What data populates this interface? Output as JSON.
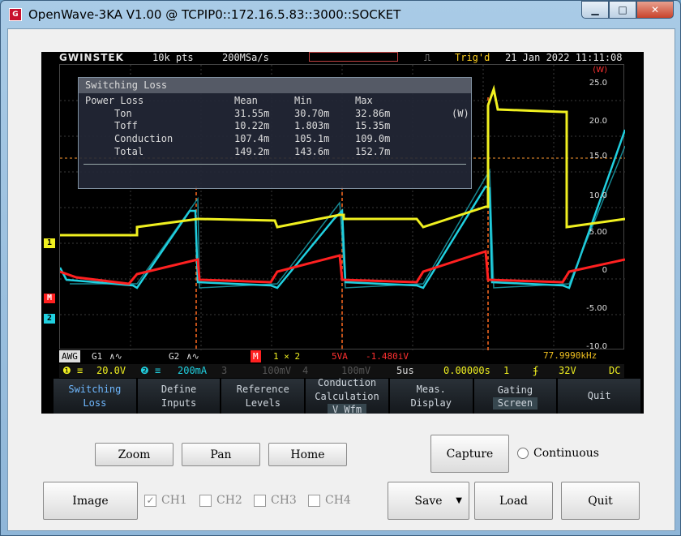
{
  "window": {
    "title": "OpenWave-3KA V1.00 @ TCPIP0::172.16.5.83::3000::SOCKET",
    "icon_text": "G",
    "minimize": "▁",
    "maximize": "□",
    "close": "✕"
  },
  "scope": {
    "brand": "GWINSTEK",
    "points": "10k pts",
    "sample_rate": "200MSa/s",
    "trig_state": "Trig'd",
    "datetime": "21 Jan 2022 11:11:08",
    "freq": "77.9990kHz",
    "right_axis_unit": "(W)",
    "right_axis": [
      "25.0",
      "20.0",
      "15.0",
      "10.0",
      "5.00",
      "0",
      "-5.00",
      "-10.0"
    ],
    "markers": {
      "ch1": "1",
      "math": "M",
      "ch2": "2"
    },
    "panel": {
      "title": "Switching Loss",
      "headers": [
        "Power Loss",
        "Mean",
        "Min",
        "Max"
      ],
      "rows": [
        {
          "name": "Ton",
          "mean": "31.55m",
          "min": "30.70m",
          "max": "32.86m",
          "unit": "(W)"
        },
        {
          "name": "Toff",
          "mean": "10.22m",
          "min": "1.803m",
          "max": "15.35m",
          "unit": ""
        },
        {
          "name": "Conduction",
          "mean": "107.4m",
          "min": "105.1m",
          "max": "109.0m",
          "unit": ""
        },
        {
          "name": "Total",
          "mean": "149.2m",
          "min": "143.6m",
          "max": "152.7m",
          "unit": ""
        }
      ]
    },
    "status1": {
      "awg": "AWG",
      "g1": "G1",
      "g2": "G2",
      "math": "M",
      "math_src": "1 × 2",
      "math_scale": "5VA",
      "math_offset": "-1.480iV"
    },
    "status2": {
      "ch1": "20.0V",
      "ch2": "200mA",
      "ch3": "100mV",
      "ch4": "100mV",
      "timebase": "5us",
      "hpos": "0.00000s",
      "trig_ch": "1",
      "trig_level": "32V",
      "coupling": "DC"
    },
    "softkeys": [
      {
        "line1": "Switching",
        "line2": "Loss",
        "active": true
      },
      {
        "line1": "Define",
        "line2": "Inputs"
      },
      {
        "line1": "Reference",
        "line2": "Levels"
      },
      {
        "line1": "Conduction",
        "line2": "Calculation",
        "sub": "V Wfm"
      },
      {
        "line1": "Meas.",
        "line2": "Display"
      },
      {
        "line1": "Gating",
        "sub": "Screen"
      },
      {
        "line1": "Quit"
      }
    ]
  },
  "controls": {
    "zoom": "Zoom",
    "pan": "Pan",
    "home": "Home",
    "capture": "Capture",
    "continuous": "Continuous",
    "image": "Image",
    "ch1": "CH1",
    "ch2": "CH2",
    "ch3": "CH3",
    "ch4": "CH4",
    "save": "Save",
    "load": "Load",
    "quit": "Quit",
    "ch1_checked": true,
    "ch2_checked": false,
    "ch3_checked": false,
    "ch4_checked": false,
    "continuous_checked": false
  },
  "colors": {
    "ch1": "#f0f020",
    "ch2": "#20d0e0",
    "math": "#ff2020",
    "accent": "#6fb8ff"
  }
}
